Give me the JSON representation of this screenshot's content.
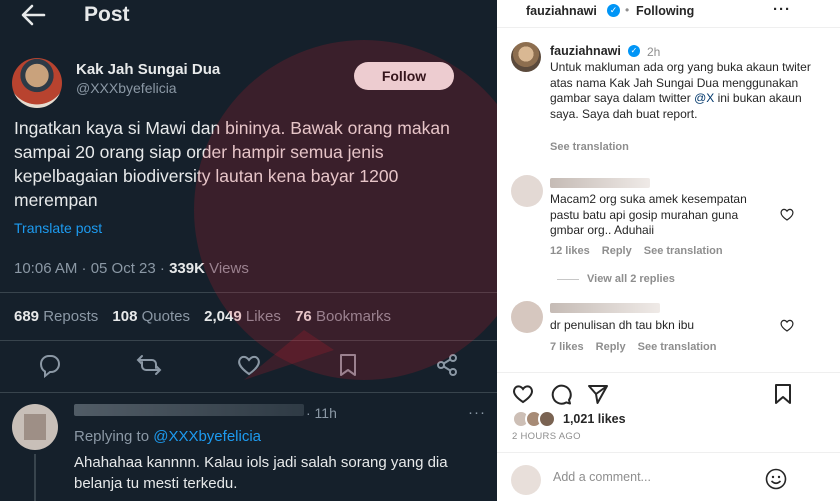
{
  "twitter": {
    "header_title": "Post",
    "author": {
      "name": "Kak Jah Sungai Dua",
      "handle": "@XXXbyefelicia"
    },
    "follow_label": "Follow",
    "text": "Ingatkan kaya si Mawi dan bininya. Bawak orang makan sampai 20 orang siap order hampir semua jenis kepelbagaian biodiversity lautan kena bayar 1200 merempan",
    "translate_label": "Translate post",
    "timestamp": "10:06 AM · 05 Oct 23 · ",
    "views_count": "339K",
    "views_label": " Views",
    "stats": {
      "reposts_count": "689",
      "reposts_label": "Reposts",
      "quotes_count": "108",
      "quotes_label": "Quotes",
      "likes_count": "2,049",
      "likes_label": "Likes",
      "bookmarks_count": "76",
      "bookmarks_label": "Bookmarks"
    },
    "reply": {
      "time": "· 11h",
      "replying_prefix": "Replying to ",
      "replying_handle": "@XXXbyefelicia",
      "text": "Ahahahaa kannnn. Kalau iols jadi salah sorang yang dia belanja tu mesti terkedu."
    }
  },
  "instagram": {
    "username": "fauziahnawi",
    "following_label": "Following",
    "caption": {
      "username": "fauziahnawi",
      "time": "2h",
      "text_before": "Untuk makluman ada org yang buka akaun twiter atas nama Kak Jah Sungai Dua menggunakan gambar saya dalam twitter ",
      "mention": "@X",
      "text_after": " ini bukan akaun saya. Saya dah buat report.",
      "see_translation": "See translation"
    },
    "comments": [
      {
        "text": "Macam2 org suka amek kesempatan pastu batu api gosip murahan guna gmbar org.. Aduhaii",
        "likes": "12 likes",
        "reply": "Reply",
        "see_translation": "See translation"
      },
      {
        "text": "dr penulisan dh tau bkn ibu",
        "likes": "7 likes",
        "reply": "Reply",
        "see_translation": "See translation"
      }
    ],
    "view_replies": "View all 2 replies",
    "likes_total": "1,021 likes",
    "posted_ago": "2 HOURS AGO",
    "add_comment_placeholder": "Add a comment..."
  },
  "colors": {
    "twitter_bg": "#15202b",
    "twitter_link": "#1d9bf0",
    "ig_verified": "#0095f6",
    "watermark": "#e11d2a"
  }
}
